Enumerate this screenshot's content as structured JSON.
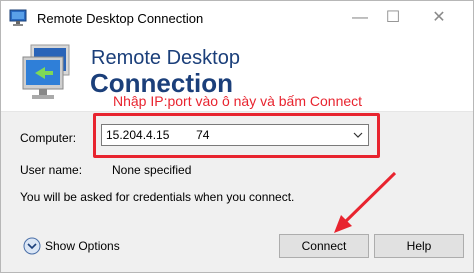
{
  "window": {
    "title": "Remote Desktop Connection",
    "minimize_icon": "minimize-icon",
    "maximize_icon": "maximize-icon",
    "close_icon": "close-icon"
  },
  "banner": {
    "line1": "Remote Desktop",
    "line2": "Connection",
    "icon": "remote-desktop-icon"
  },
  "annotation": {
    "text": "Nhập IP:port vào ô này và bấm Connect",
    "color": "#e8242f"
  },
  "form": {
    "computer_label": "Computer:",
    "computer_value": "15.204.4.15        74",
    "username_label": "User name:",
    "username_value": "None specified",
    "credentials_note": "You will be asked for credentials when you connect."
  },
  "footer": {
    "show_options_label": "Show Options",
    "connect_label": "Connect",
    "help_label": "Help"
  }
}
